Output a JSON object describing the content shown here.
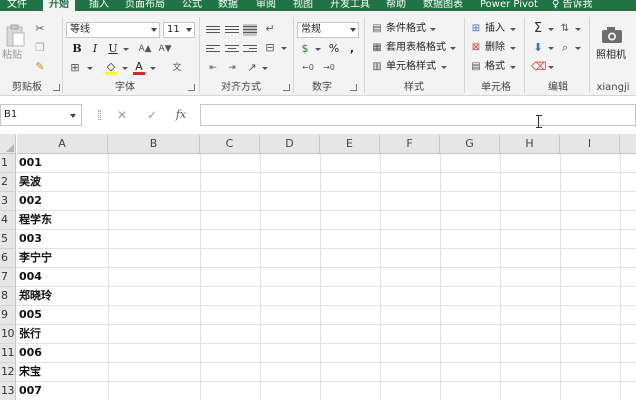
{
  "menu": {
    "tabs": [
      "文件",
      "开始",
      "插入",
      "页面布局",
      "公式",
      "数据",
      "审阅",
      "视图",
      "开发工具",
      "帮助",
      "数据图表",
      "Power Pivot"
    ],
    "active_tab": "开始",
    "tell_me": "告诉我"
  },
  "ribbon": {
    "clipboard": {
      "paste_label": "粘贴",
      "group_label": "剪贴板"
    },
    "font": {
      "font_name": "等线",
      "font_size": "11",
      "bold": "B",
      "italic": "I",
      "underline": "U",
      "font_color_glyph": "A",
      "group_label": "字体"
    },
    "alignment": {
      "group_label": "对齐方式"
    },
    "number": {
      "format": "常规",
      "percent": "%",
      "comma": ",",
      "group_label": "数字"
    },
    "styles": {
      "conditional": "条件格式",
      "table_format": "套用表格格式",
      "cell_styles": "单元格样式",
      "group_label": "样式"
    },
    "cells": {
      "insert": "插入",
      "delete": "删除",
      "format": "格式",
      "group_label": "单元格"
    },
    "editing": {
      "sum_glyph": "Σ",
      "group_label": "编辑"
    },
    "camera": {
      "label": "照相机",
      "group_label": "xiangji"
    }
  },
  "formula_bar": {
    "name_box": "B1",
    "cancel_glyph": "✕",
    "enter_glyph": "✓",
    "fx_glyph": "fx",
    "content": ""
  },
  "sheet": {
    "columns": [
      "A",
      "B",
      "C",
      "D",
      "E",
      "F",
      "G",
      "H",
      "I"
    ],
    "rows": [
      {
        "n": "1",
        "a": "001"
      },
      {
        "n": "2",
        "a": "吴波"
      },
      {
        "n": "3",
        "a": "002"
      },
      {
        "n": "4",
        "a": "程学东"
      },
      {
        "n": "5",
        "a": "003"
      },
      {
        "n": "6",
        "a": "李宁宁"
      },
      {
        "n": "7",
        "a": "004"
      },
      {
        "n": "8",
        "a": "郑晓玲"
      },
      {
        "n": "9",
        "a": "005"
      },
      {
        "n": "10",
        "a": "张行"
      },
      {
        "n": "11",
        "a": "006"
      },
      {
        "n": "12",
        "a": "宋宝"
      },
      {
        "n": "13",
        "a": "007"
      }
    ]
  },
  "colors": {
    "excel_green": "#217346",
    "ribbon_bg": "#f3f3f3",
    "highlight_yellow": "#ffff00",
    "font_red": "#e02020"
  }
}
